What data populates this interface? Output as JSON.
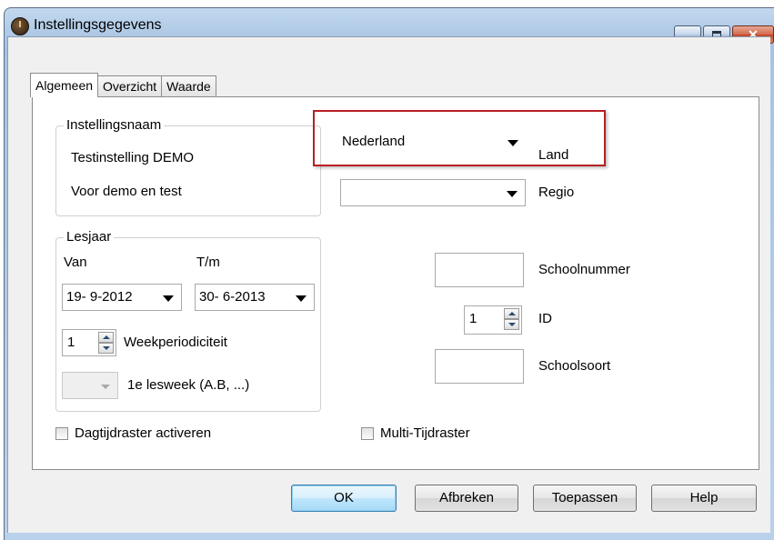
{
  "window": {
    "title": "Instellingsgegevens",
    "close_glyph": "✕"
  },
  "tabs": [
    {
      "label": "Algemeen",
      "active": true
    },
    {
      "label": "Overzicht",
      "active": false
    },
    {
      "label": "Waarde",
      "active": false
    }
  ],
  "instellingsnaam": {
    "group_title": "Instellingsnaam",
    "line1": "Testinstelling  DEMO",
    "line2": "Voor demo en test"
  },
  "lesjaar": {
    "group_title": "Lesjaar",
    "van_label": "Van",
    "tm_label": "T/m",
    "van_value": "19-  9-2012",
    "tm_value": "30-  6-2013",
    "weekperiodiciteit_value": "1",
    "weekperiodiciteit_label": "Weekperiodiciteit",
    "lesweek_value": "",
    "lesweek_label": "1e lesweek (A.B, ...)"
  },
  "right": {
    "land_value": "Nederland",
    "land_label": "Land",
    "regio_value": "",
    "regio_label": "Regio",
    "schoolnummer_value": "",
    "schoolnummer_label": "Schoolnummer",
    "id_value": "1",
    "id_label": "ID",
    "schoolsoort_value": "",
    "schoolsoort_label": "Schoolsoort"
  },
  "checkboxes": {
    "dagtijdraster_label": "Dagtijdraster activeren",
    "dagtijdraster_checked": false,
    "multi_label": "Multi-Tijdraster",
    "multi_checked": false
  },
  "buttons": {
    "ok": "OK",
    "afbreken": "Afbreken",
    "toepassen": "Toepassen",
    "help": "Help"
  },
  "colors": {
    "highlight": "#b81f24",
    "title_bar": "#a7c3e2"
  }
}
